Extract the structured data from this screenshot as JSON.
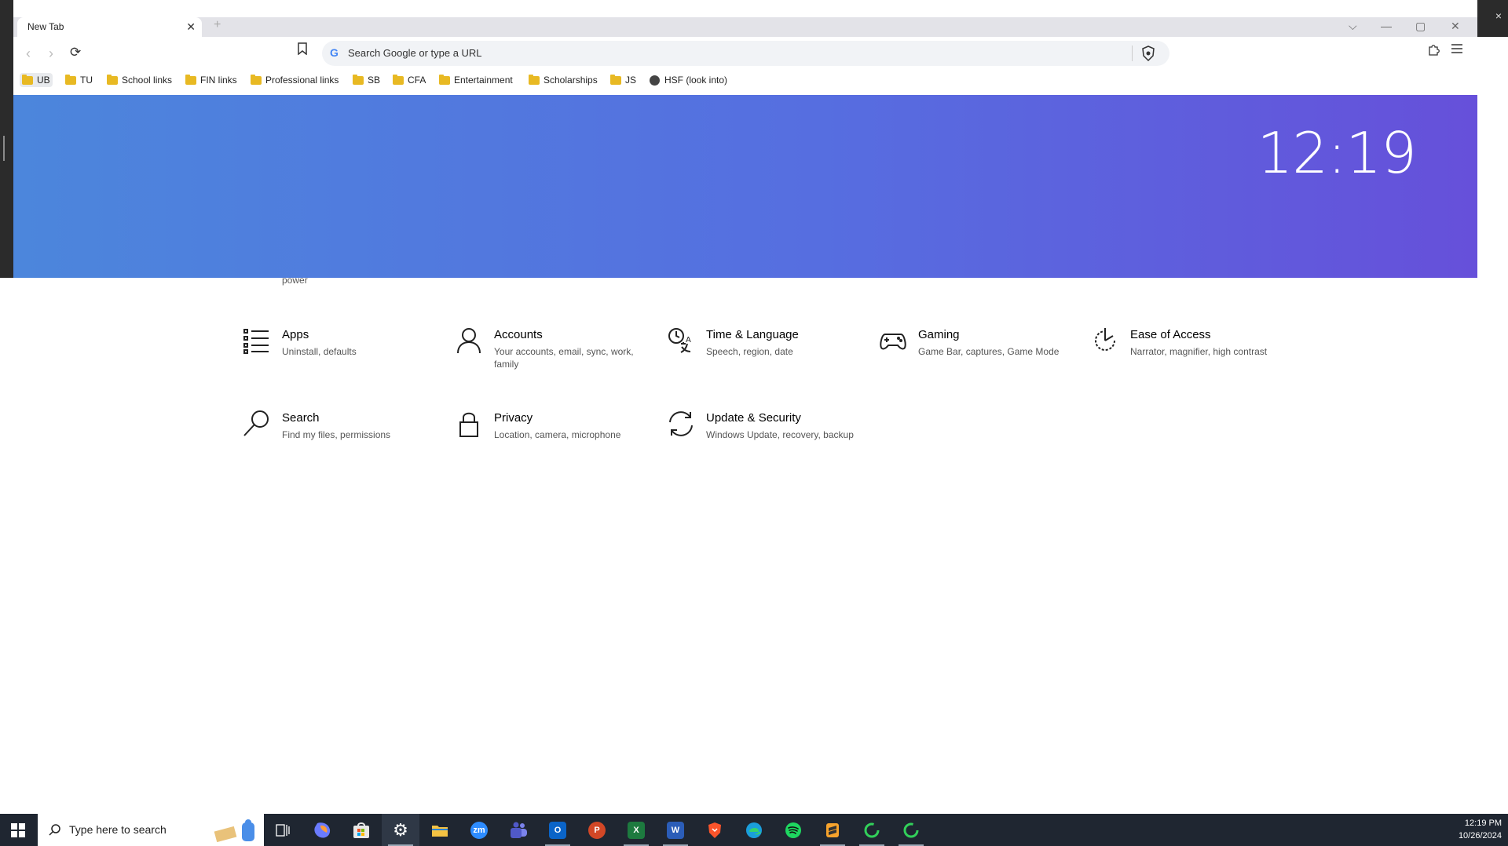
{
  "browser": {
    "tab_title": "New Tab",
    "omnibox_placeholder": "Search Google or type a URL",
    "bookmarks": [
      "UB",
      "TU",
      "School links",
      "FIN links",
      "Professional links",
      "SB",
      "CFA",
      "Entertainment",
      "Scholarships",
      "JS",
      "HSF (look into)"
    ],
    "clock": "12:19"
  },
  "settings": {
    "partial_text": "power",
    "tiles": [
      {
        "title": "Apps",
        "desc": "Uninstall, defaults",
        "icon": "apps-icon"
      },
      {
        "title": "Accounts",
        "desc": "Your accounts, email, sync, work, family",
        "icon": "accounts-icon"
      },
      {
        "title": "Time & Language",
        "desc": "Speech, region, date",
        "icon": "time-language-icon"
      },
      {
        "title": "Gaming",
        "desc": "Game Bar, captures, Game Mode",
        "icon": "gaming-icon"
      },
      {
        "title": "Ease of Access",
        "desc": "Narrator, magnifier, high contrast",
        "icon": "ease-of-access-icon"
      },
      {
        "title": "Search",
        "desc": "Find my files, permissions",
        "icon": "search-icon"
      },
      {
        "title": "Privacy",
        "desc": "Location, camera, microphone",
        "icon": "privacy-lock-icon"
      },
      {
        "title": "Update & Security",
        "desc": "Windows Update, recovery, backup",
        "icon": "update-sync-icon"
      }
    ]
  },
  "taskbar": {
    "search_placeholder": "Type here to search",
    "time": "12:19 PM",
    "date": "10/26/2024",
    "apps": [
      "task-view",
      "copilot",
      "microsoft-store",
      "settings",
      "file-explorer",
      "zoom",
      "teams",
      "outlook",
      "powerpoint",
      "excel",
      "word",
      "brave",
      "edge",
      "spotify",
      "sublime",
      "green-ring-app",
      "green-ring-app-2"
    ],
    "app_labels": {
      "zoom": "zm",
      "outlook": "O",
      "powerpoint": "P",
      "excel": "X",
      "word": "W"
    }
  }
}
